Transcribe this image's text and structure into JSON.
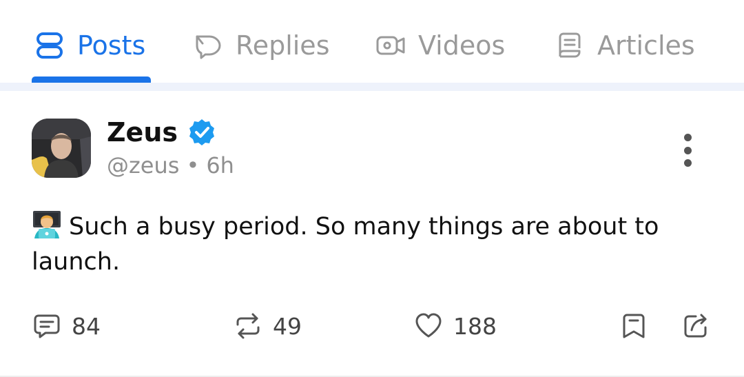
{
  "tabs": [
    {
      "label": "Posts",
      "icon": "posts-icon",
      "active": true
    },
    {
      "label": "Replies",
      "icon": "replies-icon"
    },
    {
      "label": "Videos",
      "icon": "video-icon"
    },
    {
      "label": "Articles",
      "icon": "article-icon"
    }
  ],
  "post": {
    "author_name": "Zeus",
    "verified": true,
    "handle": "@zeus",
    "separator": "•",
    "time": "6h",
    "emoji": "🧑‍💻",
    "text": "Such a busy period. So many things are about to launch.",
    "comments": "84",
    "reposts": "49",
    "likes": "188"
  },
  "colors": {
    "accent": "#1a73e8",
    "inactive_tab": "#9a9a9a",
    "verified_badge": "#1d9bf0",
    "separator_bar": "#eef2fb"
  }
}
